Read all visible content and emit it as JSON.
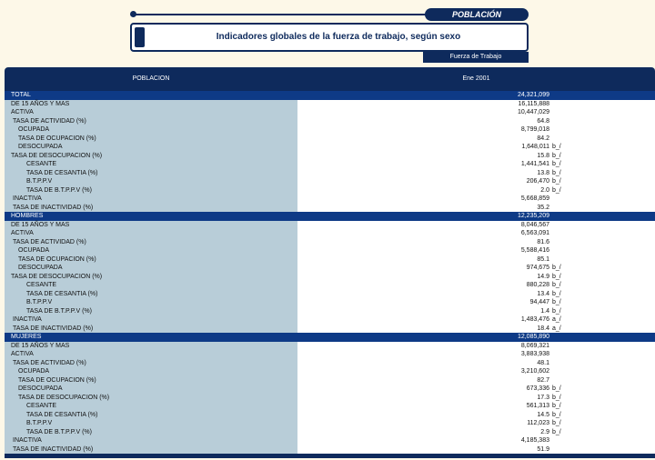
{
  "header": {
    "section_label": "POBLACIÓN",
    "title": "Indicadores globales de la fuerza de trabajo, según sexo",
    "subtitle": "Fuerza de Trabajo"
  },
  "table": {
    "col_label": "POBLACION",
    "col_period": "Ene 2001",
    "rows": [
      {
        "label": "TOTAL",
        "indent": 0,
        "value": "24,321,099",
        "note": "",
        "section": true
      },
      {
        "label": "DE 15 AÑOS Y MAS",
        "indent": 0,
        "value": "16,115,888",
        "note": "",
        "section": false
      },
      {
        "label": "ACTIVA",
        "indent": 0,
        "value": "10,447,029",
        "note": "",
        "section": false
      },
      {
        "label": "TASA DE ACTIVIDAD (%)",
        "indent": 1,
        "value": "64.8",
        "note": "",
        "section": false
      },
      {
        "label": "OCUPADA",
        "indent": 2,
        "value": "8,799,018",
        "note": "",
        "section": false
      },
      {
        "label": "TASA DE OCUPACION (%)",
        "indent": 2,
        "value": "84.2",
        "note": "",
        "section": false
      },
      {
        "label": "DESOCUPADA",
        "indent": 2,
        "value": "1,648,011",
        "note": "b_/",
        "section": false
      },
      {
        "label": "TASA DE DESOCUPACION (%)",
        "indent": 0,
        "value": "15.8",
        "note": "b_/",
        "section": false
      },
      {
        "label": "CESANTE",
        "indent": 3,
        "value": "1,441,541",
        "note": "b_/",
        "section": false
      },
      {
        "label": "TASA DE  CESANTIA (%)",
        "indent": 3,
        "value": "13.8",
        "note": "b_/",
        "section": false
      },
      {
        "label": "B.T.P.P.V",
        "indent": 3,
        "value": "206,470",
        "note": "b_/",
        "section": false
      },
      {
        "label": "TASA DE B.T.P.P.V (%)",
        "indent": 3,
        "value": "2.0",
        "note": "b_/",
        "section": false
      },
      {
        "label": "INACTIVA",
        "indent": 1,
        "value": "5,668,859",
        "note": "",
        "section": false
      },
      {
        "label": "TASA DE INACTIVIDAD (%)",
        "indent": 1,
        "value": "35.2",
        "note": "",
        "section": false
      },
      {
        "label": "HOMBRES",
        "indent": 0,
        "value": "12,235,209",
        "note": "",
        "section": true
      },
      {
        "label": "DE 15 AÑOS Y MAS",
        "indent": 0,
        "value": "8,046,567",
        "note": "",
        "section": false
      },
      {
        "label": "ACTIVA",
        "indent": 0,
        "value": "6,563,091",
        "note": "",
        "section": false
      },
      {
        "label": "TASA DE ACTIVIDAD (%)",
        "indent": 1,
        "value": "81.6",
        "note": "",
        "section": false
      },
      {
        "label": "OCUPADA",
        "indent": 2,
        "value": "5,588,416",
        "note": "",
        "section": false
      },
      {
        "label": "TASA DE OCUPACION (%)",
        "indent": 2,
        "value": "85.1",
        "note": "",
        "section": false
      },
      {
        "label": "DESOCUPADA",
        "indent": 2,
        "value": "974,675",
        "note": "b_/",
        "section": false
      },
      {
        "label": "TASA DE DESOCUPACION (%)",
        "indent": 0,
        "value": "14.9",
        "note": "b_/",
        "section": false
      },
      {
        "label": "CESANTE",
        "indent": 3,
        "value": "880,228",
        "note": "b_/",
        "section": false
      },
      {
        "label": "TASA DE  CESANTIA (%)",
        "indent": 3,
        "value": "13.4",
        "note": "b_/",
        "section": false
      },
      {
        "label": "B.T.P.P.V",
        "indent": 3,
        "value": "94,447",
        "note": "b_/",
        "section": false
      },
      {
        "label": "TASA DE B.T.P.P.V (%)",
        "indent": 3,
        "value": "1.4",
        "note": "b_/",
        "section": false
      },
      {
        "label": "INACTIVA",
        "indent": 1,
        "value": "1,483,476",
        "note": "a_/",
        "section": false
      },
      {
        "label": "TASA DE INACTIVIDAD (%)",
        "indent": 1,
        "value": "18.4",
        "note": "a_/",
        "section": false
      },
      {
        "label": "MUJERES",
        "indent": 0,
        "value": "12,085,890",
        "note": "",
        "section": true
      },
      {
        "label": "DE 15 AÑOS Y MAS",
        "indent": 0,
        "value": "8,069,321",
        "note": "",
        "section": false
      },
      {
        "label": "ACTIVA",
        "indent": 0,
        "value": "3,883,938",
        "note": "",
        "section": false
      },
      {
        "label": "TASA DE ACTIVIDAD (%)",
        "indent": 1,
        "value": "48.1",
        "note": "",
        "section": false
      },
      {
        "label": "OCUPADA",
        "indent": 2,
        "value": "3,210,602",
        "note": "",
        "section": false
      },
      {
        "label": "TASA DE OCUPACION (%)",
        "indent": 2,
        "value": "82.7",
        "note": "",
        "section": false
      },
      {
        "label": "DESOCUPADA",
        "indent": 2,
        "value": "673,336",
        "note": "b_/",
        "section": false
      },
      {
        "label": "TASA DE DESOCUPACION (%)",
        "indent": 2,
        "value": "17.3",
        "note": "b_/",
        "section": false
      },
      {
        "label": "CESANTE",
        "indent": 3,
        "value": "561,313",
        "note": "b_/",
        "section": false
      },
      {
        "label": "TASA DE  CESANTIA (%)",
        "indent": 3,
        "value": "14.5",
        "note": "b_/",
        "section": false
      },
      {
        "label": "B.T.P.P.V",
        "indent": 3,
        "value": "112,023",
        "note": "b_/",
        "section": false
      },
      {
        "label": "TASA DE B.T.P.P.V (%)",
        "indent": 3,
        "value": "2.9",
        "note": "b_/",
        "section": false
      },
      {
        "label": "INACTIVA",
        "indent": 1,
        "value": "4,185,383",
        "note": "",
        "section": false
      },
      {
        "label": "TASA DE INACTIVIDAD (%)",
        "indent": 1,
        "value": "51.9",
        "note": "",
        "section": false
      }
    ]
  }
}
